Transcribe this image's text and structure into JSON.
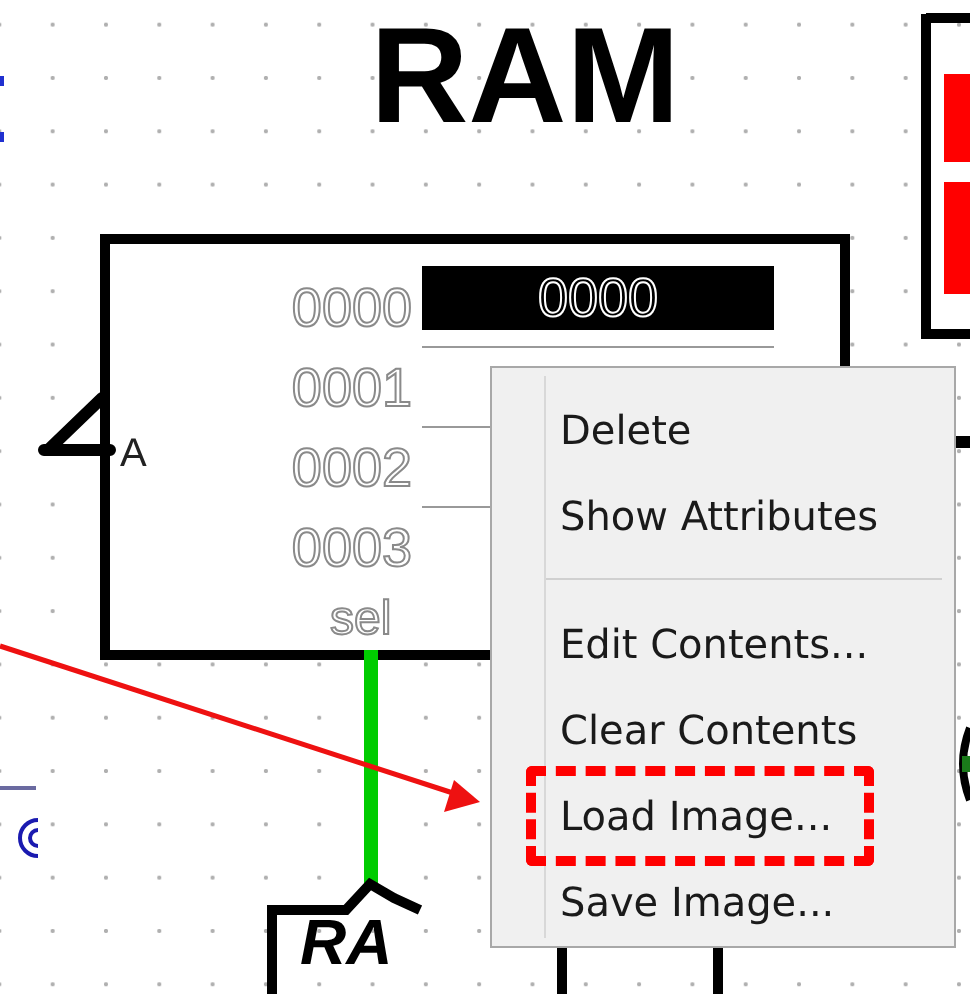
{
  "title": "RAM",
  "ram_component": {
    "address_pin_label": "A",
    "select_label": "sel",
    "rows": [
      {
        "address": "0000",
        "value": "0000",
        "selected": true
      },
      {
        "address": "0001",
        "selected": false
      },
      {
        "address": "0002",
        "selected": false
      },
      {
        "address": "0003",
        "selected": false
      }
    ]
  },
  "lower_component": {
    "label": "RA"
  },
  "context_menu": {
    "items": [
      {
        "kind": "item",
        "label": "Delete",
        "highlighted": false
      },
      {
        "kind": "item",
        "label": "Show Attributes",
        "highlighted": false
      },
      {
        "kind": "separator"
      },
      {
        "kind": "item",
        "label": "Edit Contents...",
        "highlighted": false
      },
      {
        "kind": "item",
        "label": "Clear Contents",
        "highlighted": false
      },
      {
        "kind": "item",
        "label": "Load Image...",
        "highlighted": true
      },
      {
        "kind": "item",
        "label": "Save Image...",
        "highlighted": false
      }
    ]
  }
}
